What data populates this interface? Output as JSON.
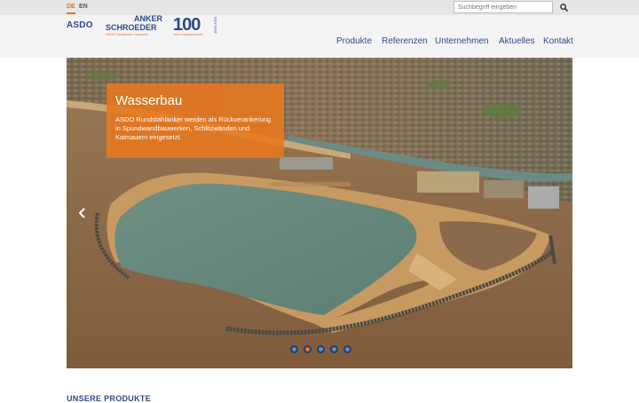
{
  "languages": [
    {
      "label": "DE",
      "active": true
    },
    {
      "label": "EN",
      "active": false
    }
  ],
  "search": {
    "placeholder": "Suchbegriff eingeben",
    "icon": "search-icon"
  },
  "logos": {
    "asdo": "ASDO",
    "anker_schroeder_line1": "ANKER",
    "anker_schroeder_line2": "SCHROEDER",
    "anker_schroeder_tagline": "ASDO worldwide members",
    "centenary_number": "100",
    "centenary_years": "1920-2020",
    "centenary_tagline": "Jahre Ankerschroeder"
  },
  "nav": {
    "items": [
      {
        "label": "Produkte"
      },
      {
        "label": "Referenzen"
      },
      {
        "label": "Unternehmen"
      },
      {
        "label": "Aktuelles"
      },
      {
        "label": "Kontakt"
      }
    ]
  },
  "hero": {
    "title": "Wasserbau",
    "text": "ASDO Rundstahlanker werden als Rückverankerung in Spundwandbauwerken, Schlitzwänden und Kaimauern eingesetzt.",
    "prev_icon": "chevron-left-icon",
    "slide_count": 5,
    "active_slide": 2
  },
  "products": {
    "heading": "UNSERE PRODUKTE"
  },
  "colors": {
    "accent": "#e8741e",
    "brand_blue": "#2c4a8a",
    "topbar": "#e6e6e6",
    "header": "#f4f4f4"
  }
}
